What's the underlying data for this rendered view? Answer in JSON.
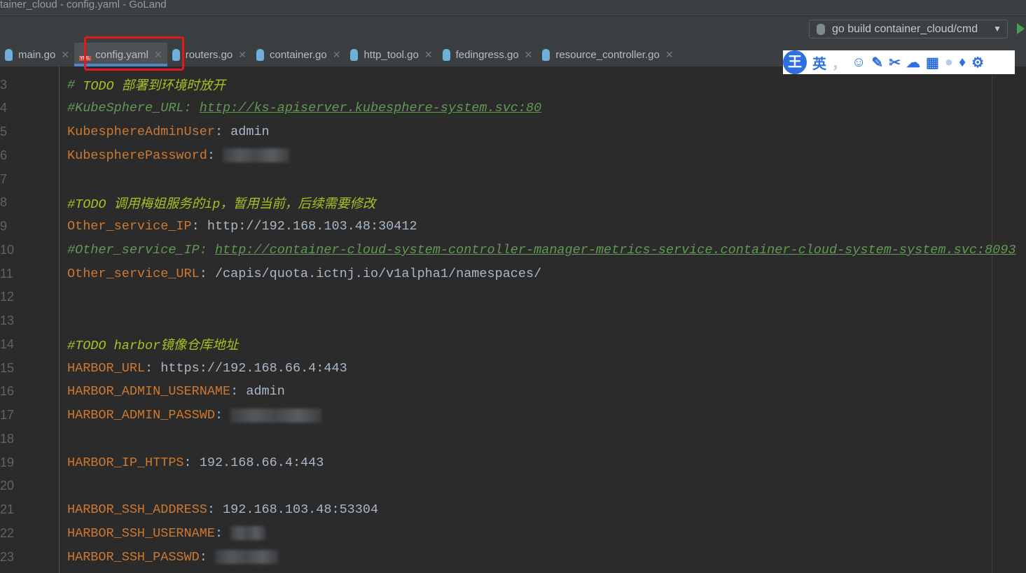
{
  "window": {
    "title": "tainer_cloud - config.yaml - GoLand"
  },
  "toolbar": {
    "run_config": "go build container_cloud/cmd"
  },
  "tabs": [
    {
      "label": "main.go",
      "icon": "gopher-icon"
    },
    {
      "label": "config.yaml",
      "icon": "yaml-icon",
      "active": true
    },
    {
      "label": "routers.go",
      "icon": "gopher-icon"
    },
    {
      "label": "container.go",
      "icon": "gopher-icon"
    },
    {
      "label": "http_tool.go",
      "icon": "gopher-icon"
    },
    {
      "label": "fedingress.go",
      "icon": "gopher-icon"
    },
    {
      "label": "resource_controller.go",
      "icon": "gopher-icon"
    }
  ],
  "ime": {
    "logo": "王",
    "mode": "英",
    "punct": "，"
  },
  "accent": "#e5191c",
  "lines": [
    {
      "n": "3",
      "parts": [
        {
          "c": "cmt",
          "t": "# "
        },
        {
          "c": "todo",
          "t": "TODO 部署到环境时放开"
        }
      ]
    },
    {
      "n": "4",
      "parts": [
        {
          "c": "cmt",
          "t": "#KubeSphere_URL: "
        },
        {
          "c": "url",
          "t": "http://ks-apiserver.kubesphere-system.svc:80"
        }
      ]
    },
    {
      "n": "5",
      "parts": [
        {
          "c": "key",
          "t": "KubesphereAdminUser"
        },
        {
          "c": "val",
          "t": ": admin"
        }
      ]
    },
    {
      "n": "6",
      "parts": [
        {
          "c": "key",
          "t": "KubespherePassword"
        },
        {
          "c": "val",
          "t": ": "
        }
      ],
      "blur": 95
    },
    {
      "n": "7",
      "parts": []
    },
    {
      "n": "8",
      "parts": [
        {
          "c": "todo",
          "t": "#TODO 调用梅姐服务的ip，暂用当前，后续需要修改"
        }
      ]
    },
    {
      "n": "9",
      "parts": [
        {
          "c": "key",
          "t": "Other_service_IP"
        },
        {
          "c": "val",
          "t": ": http://192.168.103.48:30412"
        }
      ]
    },
    {
      "n": "10",
      "parts": [
        {
          "c": "cmt",
          "t": "#Other_service_IP: "
        },
        {
          "c": "url",
          "t": "http://container-cloud-system-controller-manager-metrics-service.container-cloud-system-system.svc:8093"
        }
      ]
    },
    {
      "n": "11",
      "parts": [
        {
          "c": "key",
          "t": "Other_service_URL"
        },
        {
          "c": "val",
          "t": ": /capis/quota.ictnj.io/v1alpha1/namespaces/"
        }
      ]
    },
    {
      "n": "12",
      "parts": []
    },
    {
      "n": "13",
      "parts": []
    },
    {
      "n": "14",
      "parts": [
        {
          "c": "todo",
          "t": "#TODO harbor镜像仓库地址"
        }
      ]
    },
    {
      "n": "15",
      "parts": [
        {
          "c": "key",
          "t": "HARBOR_URL"
        },
        {
          "c": "val",
          "t": ": https://192.168.66.4:443"
        }
      ]
    },
    {
      "n": "16",
      "parts": [
        {
          "c": "key",
          "t": "HARBOR_ADMIN_USERNAME"
        },
        {
          "c": "val",
          "t": ": admin"
        }
      ]
    },
    {
      "n": "17",
      "parts": [
        {
          "c": "key",
          "t": "HARBOR_ADMIN_PASSWD"
        },
        {
          "c": "val",
          "t": ": "
        }
      ],
      "blur": 130
    },
    {
      "n": "18",
      "parts": []
    },
    {
      "n": "19",
      "parts": [
        {
          "c": "key",
          "t": "HARBOR_IP_HTTPS"
        },
        {
          "c": "val",
          "t": ": 192.168.66.4:443"
        }
      ]
    },
    {
      "n": "20",
      "parts": []
    },
    {
      "n": "21",
      "parts": [
        {
          "c": "key",
          "t": "HARBOR_SSH_ADDRESS"
        },
        {
          "c": "val",
          "t": ": 192.168.103.48:53304"
        }
      ]
    },
    {
      "n": "22",
      "parts": [
        {
          "c": "key",
          "t": "HARBOR_SSH_USERNAME"
        },
        {
          "c": "val",
          "t": ": "
        }
      ],
      "blur": 50
    },
    {
      "n": "23",
      "parts": [
        {
          "c": "key",
          "t": "HARBOR_SSH_PASSWD"
        },
        {
          "c": "val",
          "t": ": "
        }
      ],
      "blur": 90
    }
  ]
}
